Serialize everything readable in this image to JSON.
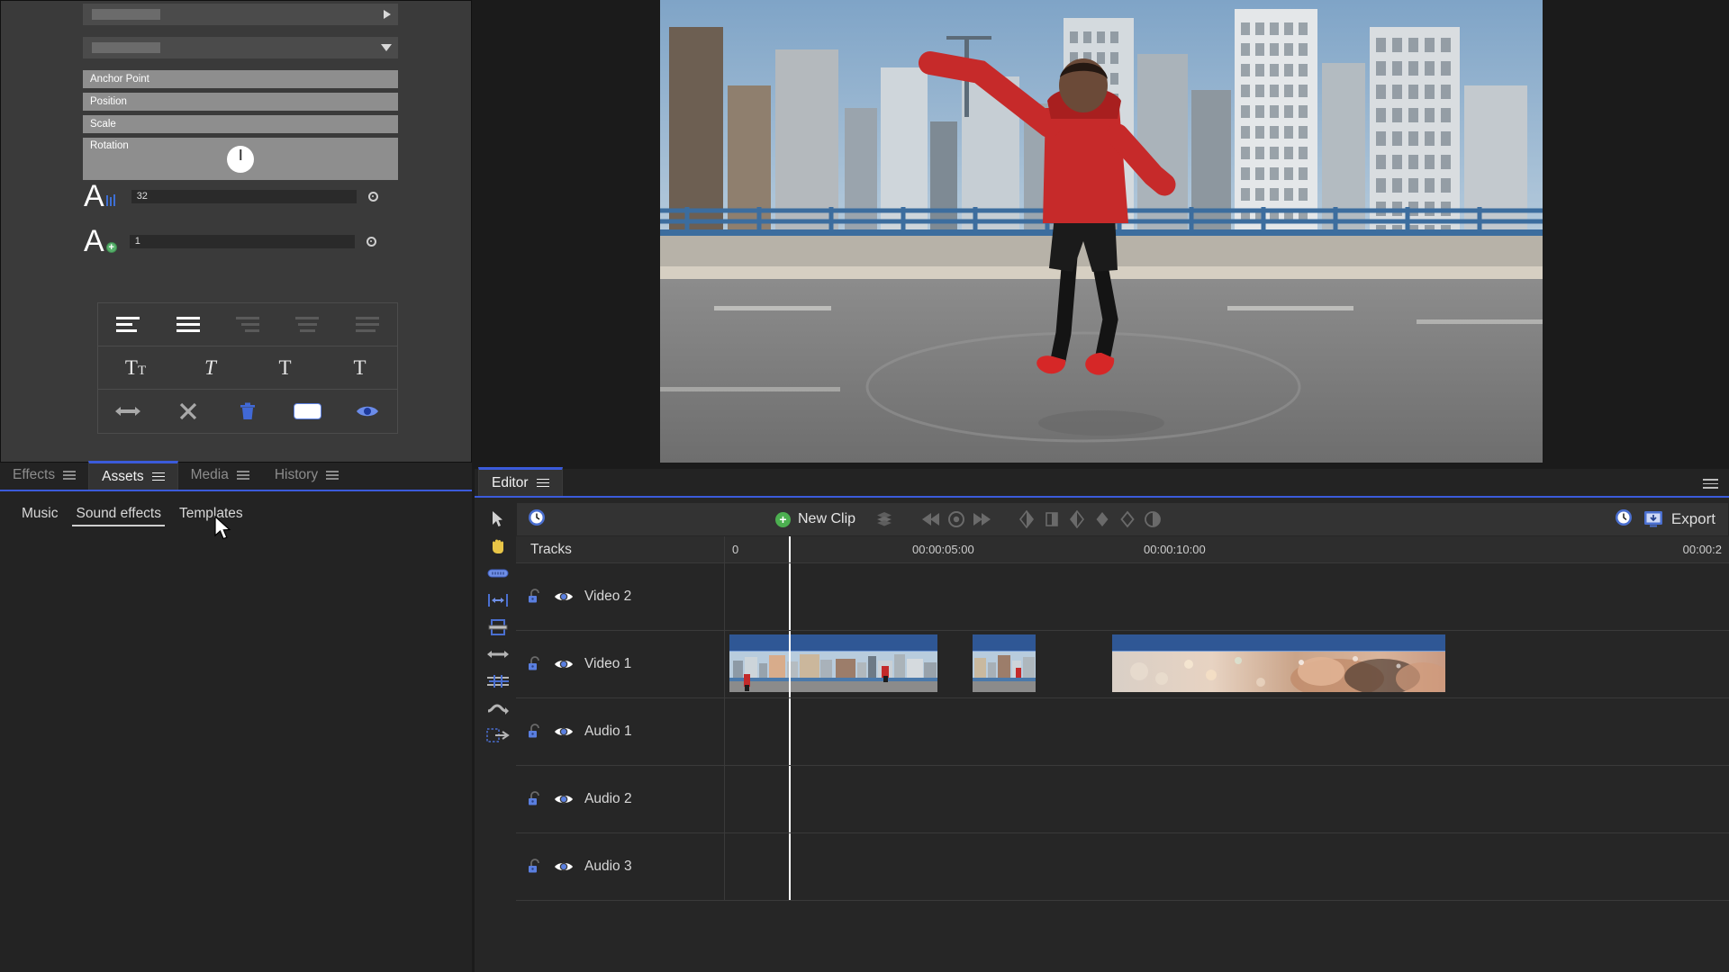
{
  "inspector": {
    "properties": [
      {
        "label": "",
        "type": "placeholder",
        "arrow": "right"
      },
      {
        "label": "",
        "type": "placeholder",
        "arrow": "down"
      },
      {
        "label": "Anchor Point",
        "type": "grey",
        "arrow": "right"
      },
      {
        "label": "Position",
        "type": "grey",
        "arrow": "right"
      },
      {
        "label": "Scale",
        "type": "grey",
        "arrow": "right"
      },
      {
        "label": "Rotation",
        "type": "rotation",
        "arrow": "down"
      }
    ],
    "font_size": {
      "value": "32",
      "icon": "font-size-icon"
    },
    "line_spacing": {
      "value": "1",
      "icon": "line-spacing-icon"
    },
    "text_styles": {
      "align_row": [
        "align-left-icon",
        "align-justify-icon",
        "align-right-dim-icon",
        "align-center-dim-icon",
        "align-justify-dim-icon"
      ],
      "case_row": [
        "all-caps-icon",
        "italic-icon",
        "normal-text-icon",
        "thin-text-icon"
      ],
      "action_row": [
        "horizontal-arrows-icon",
        "close-x-icon",
        "delete-trash-icon",
        "color-swatch-icon",
        "visibility-eye-icon"
      ],
      "labels": {
        "all_caps": "T",
        "all_caps_small": "T",
        "italic": "T",
        "normal": "T",
        "thin": "T"
      }
    }
  },
  "left_panel": {
    "tabs": [
      {
        "label": "Effects",
        "active": false
      },
      {
        "label": "Assets",
        "active": true
      },
      {
        "label": "Media",
        "active": false
      },
      {
        "label": "History",
        "active": false
      }
    ],
    "subtabs": [
      {
        "label": "Music",
        "active": false
      },
      {
        "label": "Sound effects",
        "active": true
      },
      {
        "label": "Templates",
        "active": false
      }
    ]
  },
  "editor": {
    "tab_label": "Editor",
    "toolbar": {
      "new_clip_label": "New Clip",
      "clock_icon": "clock-icon",
      "export_label": "Export",
      "export_icon": "export-monitor-icon",
      "icons": [
        "stack-clips-icon",
        "rewind-icon",
        "record-icon",
        "fast-forward-icon",
        "keyframe-in-icon",
        "keyframe-split-icon",
        "keyframe-left-icon",
        "keyframe-diamond-icon",
        "keyframe-outline-icon",
        "keyframe-half-icon"
      ]
    },
    "tools": [
      "select-arrow-icon",
      "hand-pan-icon",
      "razor-blade-icon",
      "trim-both-icon",
      "crop-icon",
      "resize-horizontal-icon",
      "slip-icon",
      "roll-edit-icon",
      "slide-box-icon"
    ],
    "timeline": {
      "tracks_header": "Tracks",
      "ticks": [
        {
          "label": "0",
          "pos_pct": 1.0
        },
        {
          "label": "00:00:05:00",
          "pos_pct": 18.5
        },
        {
          "label": "00:00:10:00",
          "pos_pct": 40.5
        },
        {
          "label": "00:00:2",
          "pos_pct": 68.0
        }
      ],
      "playhead_pct": 13.9,
      "tracks": [
        {
          "name": "Video 2",
          "lock": "unlocked-icon",
          "visibility": "eye-icon",
          "clips": []
        },
        {
          "name": "Video 1",
          "lock": "unlocked-icon",
          "visibility": "eye-icon",
          "clips": [
            {
              "id": "clip-1",
              "left_pct": 0.4,
              "width_pct": 20.0,
              "theme": "city"
            },
            {
              "id": "clip-2",
              "left_pct": 24.0,
              "width_pct": 6.1,
              "theme": "city"
            },
            {
              "id": "clip-3",
              "left_pct": 37.5,
              "width_pct": 31.9,
              "theme": "bokeh"
            }
          ]
        }
      ],
      "audio_tracks": [
        {
          "name": "Audio 1",
          "lock": "unlocked-icon",
          "visibility": "eye-icon"
        },
        {
          "name": "Audio 2",
          "lock": "unlocked-icon",
          "visibility": "eye-icon"
        },
        {
          "name": "Audio 3",
          "lock": "unlocked-icon",
          "visibility": "eye-icon"
        }
      ]
    }
  },
  "colors": {
    "accent_blue": "#3b5bdb",
    "clip_header": "#2f5795",
    "panel_bg": "#232323",
    "inspector_bg": "#3a3a3a",
    "icon_blue": "#5a7fe0",
    "green": "#4caf50"
  }
}
